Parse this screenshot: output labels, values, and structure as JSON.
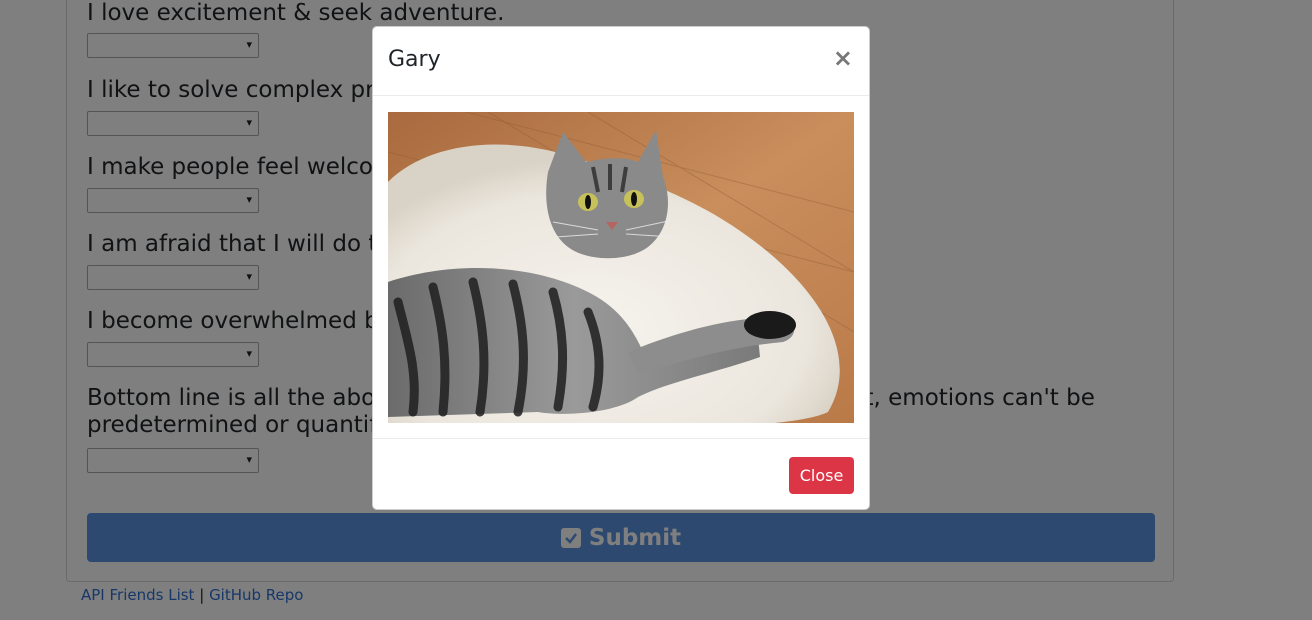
{
  "form": {
    "questions": [
      {
        "label": "I love excitement & seek adventure."
      },
      {
        "label": "I like to solve complex problems."
      },
      {
        "label": "I make people feel welcome."
      },
      {
        "label": "I am afraid that I will do the wrong thing."
      },
      {
        "label": "I become overwhelmed by events."
      },
      {
        "label": "Bottom line is all the above questions are only effective if you feel it, emotions can't be predetermined or quantified."
      }
    ],
    "select_arrow": "▾",
    "submit_label": "Submit"
  },
  "footer": {
    "link1": "API Friends List",
    "separator": "|",
    "link2": "GitHub Repo"
  },
  "modal": {
    "title": "Gary",
    "close_symbol": "×",
    "close_label": "Close",
    "image_alt": "tabby cat lying on white fur rug"
  }
}
